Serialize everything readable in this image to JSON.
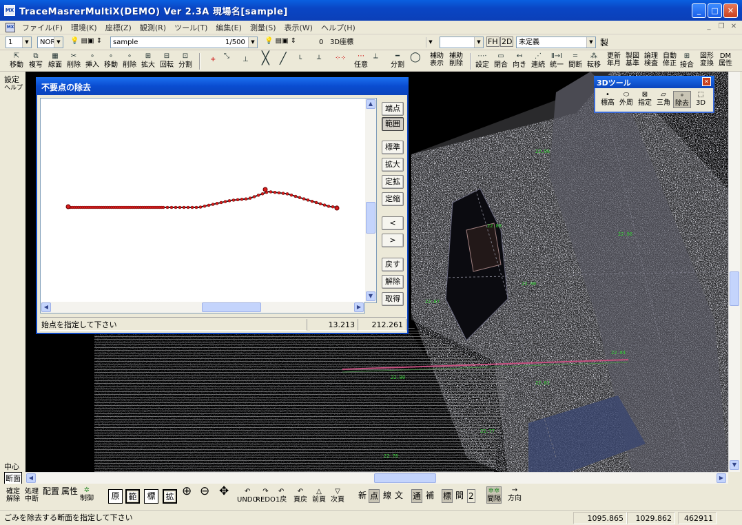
{
  "window": {
    "title": "TraceMasrerMultiX(DEMO) Ver 2.3A  現場名[sample]",
    "app_icon": "MX"
  },
  "menu": [
    "ファイル(F)",
    "環境(K)",
    "座標(Z)",
    "観測(R)",
    "ツール(T)",
    "編集(E)",
    "測量(S)",
    "表示(W)",
    "ヘルプ(H)"
  ],
  "combos": {
    "layer_number": "1",
    "mode": "NOR",
    "layer_name": "sample",
    "scale": "1/500",
    "coord_number": "0",
    "coord_name": "3D座標",
    "blank": "",
    "fh": "FH",
    "dim": "2D",
    "attribute": "未定義",
    "make": "製"
  },
  "toolbar": [
    {
      "label": "移動",
      "icon": "move-icon"
    },
    {
      "label": "複写",
      "icon": "copy-icon"
    },
    {
      "label": "線面",
      "icon": "line-face-icon"
    },
    {
      "label": "削除",
      "icon": "delete-icon"
    },
    {
      "label": "挿入",
      "icon": "insert-icon"
    },
    {
      "label": "移動",
      "icon": "move-point-icon"
    },
    {
      "label": "削除",
      "icon": "delete-point-icon"
    },
    {
      "label": "拡大",
      "icon": "enlarge-icon"
    },
    {
      "label": "回転",
      "icon": "rotate-icon"
    },
    {
      "label": "分割",
      "icon": "split-icon"
    },
    {
      "label": "任意",
      "icon": "arbitrary-icon"
    },
    {
      "label": "分割",
      "icon": "divide-icon"
    },
    {
      "label": "補助表示",
      "icon": ""
    },
    {
      "label": "補助削除",
      "icon": ""
    },
    {
      "label": "設定",
      "icon": "settings-icon"
    },
    {
      "label": "閉合",
      "icon": "close-shape-icon"
    },
    {
      "label": "向き",
      "icon": "direction-icon"
    },
    {
      "label": "連続",
      "icon": "continuous-icon"
    },
    {
      "label": "統一",
      "icon": "unify-icon"
    },
    {
      "label": "間断",
      "icon": "gap-icon"
    },
    {
      "label": "転移",
      "icon": "transfer-icon"
    },
    {
      "label": "更新年月",
      "icon": ""
    },
    {
      "label": "製図基準",
      "icon": ""
    },
    {
      "label": "論理検査",
      "icon": ""
    },
    {
      "label": "自動修正",
      "icon": ""
    },
    {
      "label": "接合",
      "icon": "join-icon"
    },
    {
      "label": "図形変換",
      "icon": ""
    },
    {
      "label": "DM属性",
      "icon": ""
    }
  ],
  "left_panel": {
    "settings": "設定",
    "help": "ヘルプ",
    "center": "中心",
    "section": "断面"
  },
  "dialog": {
    "title": "不要点の除去",
    "buttons": [
      {
        "label": "端点",
        "active": false
      },
      {
        "label": "範囲",
        "active": true
      },
      {
        "label": "標準",
        "active": false
      },
      {
        "label": "拡大",
        "active": false
      },
      {
        "label": "定拡",
        "active": false
      },
      {
        "label": "定縮",
        "active": false
      },
      {
        "label": "<",
        "active": false
      },
      {
        "label": ">",
        "active": false
      },
      {
        "label": "戻す",
        "active": false
      },
      {
        "label": "解除",
        "active": false
      },
      {
        "label": "取得",
        "active": false
      }
    ],
    "status_message": "始点を指定して下さい",
    "coord_x": "13.213",
    "coord_y": "212.261"
  },
  "tools3d": {
    "title": "3Dツール",
    "items": [
      {
        "label": "標高",
        "icon": "point-icon",
        "active": false
      },
      {
        "label": "外周",
        "icon": "outline-icon",
        "active": false
      },
      {
        "label": "指定",
        "icon": "specify-icon",
        "active": false
      },
      {
        "label": "三角",
        "icon": "triangle-icon",
        "active": false
      },
      {
        "label": "除去",
        "icon": "remove-icon",
        "active": true
      },
      {
        "label": "3D",
        "icon": "3d-box-icon",
        "active": false
      }
    ]
  },
  "bottom_toolbar": {
    "confirm": "確定解除",
    "process": "処理中断",
    "layout": "配置",
    "attribute": "属性",
    "control": "制御",
    "box_buttons": [
      {
        "label": "原",
        "active": false
      },
      {
        "label": "範",
        "active": true
      },
      {
        "label": "標",
        "active": false
      },
      {
        "label": "拡",
        "active": true
      }
    ],
    "undo": "UNDO",
    "redo": "REDO",
    "back1": "1戻",
    "page_back": "頁戻",
    "prev_page": "前頁",
    "next_page": "次頁",
    "modes": [
      {
        "label": "新",
        "active": false
      },
      {
        "label": "点",
        "active": true
      },
      {
        "label": "線",
        "active": false
      },
      {
        "label": "文",
        "active": false
      },
      {
        "label": "通",
        "active": true
      },
      {
        "label": "補",
        "active": false
      },
      {
        "label": "標",
        "active": true
      },
      {
        "label": "間",
        "active": false
      },
      {
        "label": "2",
        "active": false
      }
    ],
    "interval": "間隔",
    "direction": "方向"
  },
  "status": {
    "message": "ごみを除去する断面を指定して下さい",
    "coord_x": "1095.865",
    "coord_y": "1029.862",
    "count": "462911"
  }
}
